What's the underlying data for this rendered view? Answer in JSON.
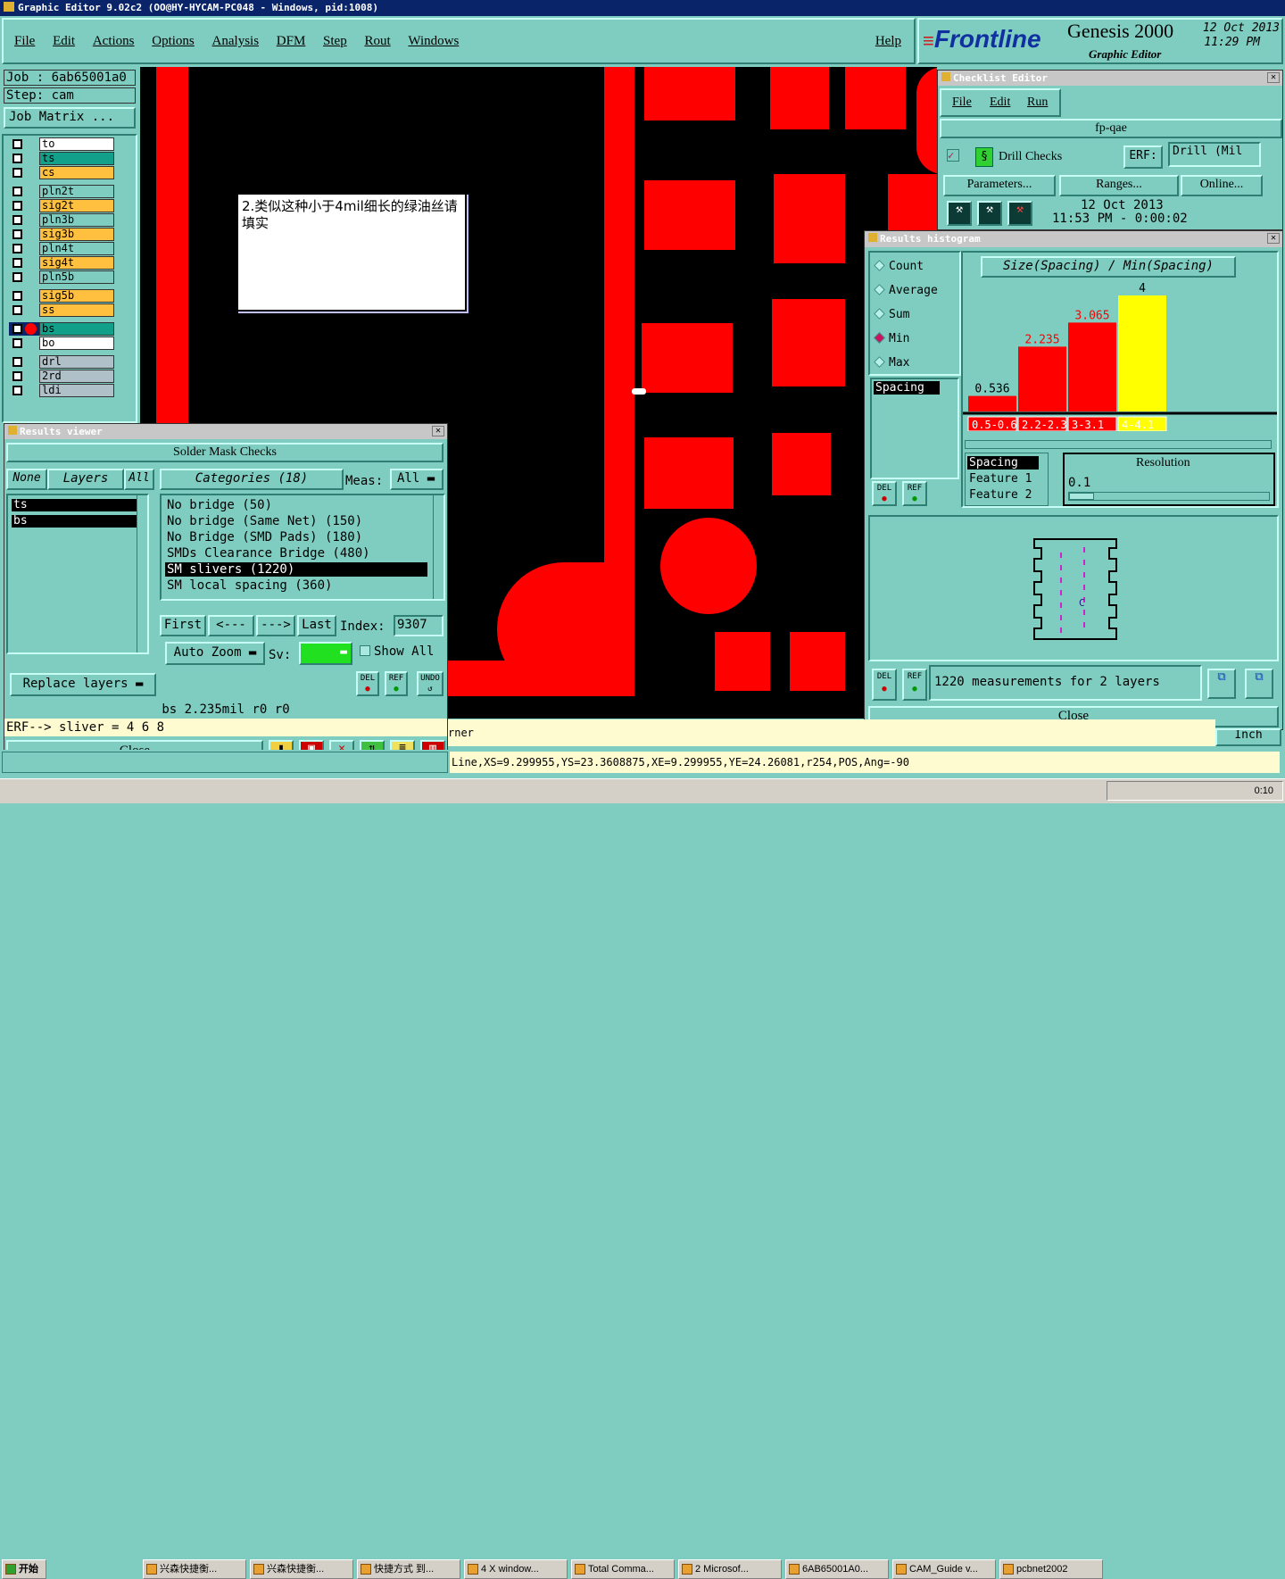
{
  "window_title": "Graphic Editor 9.02c2 (OO@HY-HYCAM-PC048 - Windows, pid:1008)",
  "menu": [
    "File",
    "Edit",
    "Actions",
    "Options",
    "Analysis",
    "DFM",
    "Step",
    "Rout",
    "Windows"
  ],
  "help": "Help",
  "brand": {
    "logo": "Frontline",
    "product": "Genesis 2000",
    "subtitle": "Graphic Editor",
    "date": "12 Oct 2013",
    "time": "11:29 PM"
  },
  "job": {
    "job": "Job : 6ab65001a0",
    "step": "Step: cam",
    "matrix_button": "Job Matrix ..."
  },
  "layers": [
    {
      "name": "to",
      "color": "#ffffff"
    },
    {
      "name": "ts",
      "color": "#12a08a"
    },
    {
      "name": "cs",
      "color": "#ffc040"
    },
    {
      "name": "pln2t",
      "color": "#7ecdc0"
    },
    {
      "name": "sig2t",
      "color": "#ffc040"
    },
    {
      "name": "pln3b",
      "color": "#7ecdc0"
    },
    {
      "name": "sig3b",
      "color": "#ffc040"
    },
    {
      "name": "pln4t",
      "color": "#7ecdc0"
    },
    {
      "name": "sig4t",
      "color": "#ffc040"
    },
    {
      "name": "pln5b",
      "color": "#7ecdc0"
    },
    {
      "name": "sig5b",
      "color": "#ffc040"
    },
    {
      "name": "ss",
      "color": "#ffc040"
    },
    {
      "name": "bs",
      "color": "#12a08a"
    },
    {
      "name": "bo",
      "color": "#ffffff"
    },
    {
      "name": "drl",
      "color": "#b0c0c8"
    },
    {
      "name": "2rd",
      "color": "#b0c0c8"
    },
    {
      "name": "ldi",
      "color": "#b0c0c8"
    }
  ],
  "note": "2.类似这种小于4mil细长的绿油丝请填实",
  "results_viewer": {
    "title": "Results viewer",
    "header": "Solder Mask Checks",
    "none": "None",
    "layers_tab": "Layers",
    "all": "All",
    "layer_items": [
      "ts",
      "bs"
    ],
    "categories_label": "Categories (18)",
    "meas_label": "Meas:",
    "meas_value": "All",
    "categories": [
      "No bridge (50)",
      "No bridge (Same Net) (150)",
      "No Bridge (SMD Pads) (180)",
      "SMDs Clearance Bridge (480)",
      "SM slivers (1220)",
      "SM local spacing (360)"
    ],
    "first": "First",
    "prev": "<---",
    "next": "--->",
    "last": "Last",
    "index_label": "Index:",
    "index_value": "9307",
    "auto_zoom": "Auto Zoom",
    "sv": "Sv:",
    "show_all": "Show All",
    "replace_layers": "Replace layers",
    "del": "DEL",
    "ref": "REF",
    "undo": "UNDO",
    "status": "bs 2.235mil  r0  r0",
    "erf": "ERF--> sliver = 4 6 8",
    "close": "Close"
  },
  "checklist": {
    "title": "Checklist Editor",
    "menu": [
      "File",
      "Edit",
      "Run"
    ],
    "name": "fp-qae",
    "check": "Drill Checks",
    "erf": "ERF:",
    "erf_value": "Drill (Mil",
    "params": "Parameters...",
    "ranges": "Ranges...",
    "online": "Online...",
    "date": "12 Oct 2013",
    "time": "11:53 PM - 0:00:02"
  },
  "histogram": {
    "title": "Results histogram",
    "options": [
      "Count",
      "Average",
      "Sum",
      "Min",
      "Max"
    ],
    "selected": "Min",
    "listbox_item": "Spacing",
    "heading": "Size(Spacing) / Min(Spacing)",
    "table_items": [
      "Spacing",
      "Feature 1",
      "Feature 2"
    ],
    "resolution_label": "Resolution",
    "resolution_value": "0.1",
    "measurements": "1220 measurements for 2 layers",
    "close": "Close",
    "del": "DEL",
    "ref": "REF"
  },
  "chart_data": {
    "type": "bar",
    "categories": [
      "0.5-0.6",
      "2.2-2.3",
      "3-3.1",
      "4-4.1"
    ],
    "values": [
      0.536,
      2.235,
      3.065,
      4
    ],
    "value_labels": [
      "0.536",
      "2.235",
      "3.065",
      "4"
    ],
    "colors": [
      "#ff0000",
      "#ff0000",
      "#ff0000",
      "#ffff00"
    ],
    "title": "Size(Spacing) / Min(Spacing)",
    "ylim": [
      0,
      4
    ]
  },
  "status_line": "Line,XS=9.299955,YS=23.3608875,XE=9.299955,YE=24.26081,r254,POS,Ang=-90",
  "info_line": "rner",
  "units": "Inch",
  "taskbar": {
    "start": "开始",
    "items": [
      "兴森快捷衡...",
      "兴森快捷衡...",
      "快捷方式 到...",
      "4 X window...",
      "Total Comma...",
      "2 Microsof...",
      "6AB65001A0...",
      "CAM_Guide v...",
      "pcbnet2002"
    ],
    "clock": "0:10"
  }
}
